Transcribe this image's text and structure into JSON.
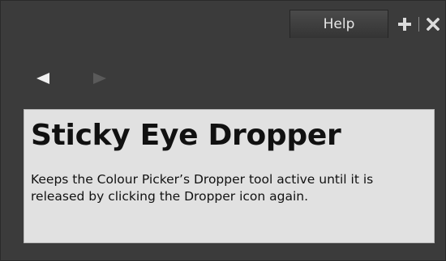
{
  "header": {
    "help_tab_label": "Help",
    "icons": [
      "plus-icon",
      "close-icon"
    ]
  },
  "nav": {
    "back_icon": "triangle-left-icon",
    "forward_icon": "triangle-right-icon"
  },
  "content": {
    "title": "Sticky Eye Dropper",
    "description": "Keeps the Colour Picker’s Dropper tool active until it is released by clicking the Dropper icon again."
  },
  "colors": {
    "panel_bg": "#3b3b3b",
    "content_bg": "#e1e1e1",
    "icon_color": "#dcdcdc",
    "disabled_icon": "#5a5a5a"
  }
}
